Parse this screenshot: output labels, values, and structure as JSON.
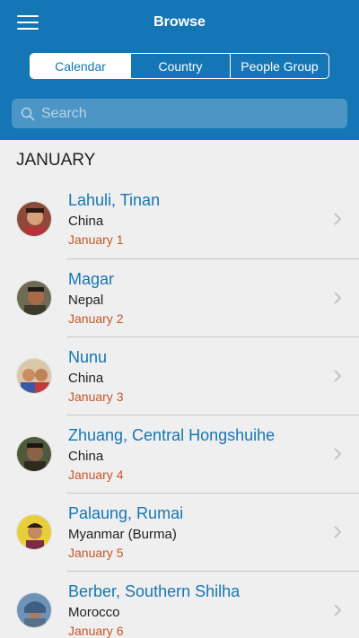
{
  "header": {
    "title": "Browse",
    "tabs": [
      {
        "label": "Calendar",
        "active": true
      },
      {
        "label": "Country",
        "active": false
      },
      {
        "label": "People Group",
        "active": false
      }
    ],
    "search_placeholder": "Search",
    "background_color": "#1576b5"
  },
  "section": {
    "header": "JANUARY"
  },
  "people_groups": [
    {
      "name": "Lahuli, Tinan",
      "country": "China",
      "date": "January 1"
    },
    {
      "name": "Magar",
      "country": "Nepal",
      "date": "January 2"
    },
    {
      "name": "Nunu",
      "country": "China",
      "date": "January 3"
    },
    {
      "name": "Zhuang, Central Hongshuihe",
      "country": "China",
      "date": "January 4"
    },
    {
      "name": "Palaung, Rumai",
      "country": "Myanmar (Burma)",
      "date": "January 5"
    },
    {
      "name": "Berber, Southern Shilha",
      "country": "Morocco",
      "date": "January 6"
    }
  ],
  "colors": {
    "name": "#1576b5",
    "date": "#c8552a",
    "background": "#efefef"
  }
}
